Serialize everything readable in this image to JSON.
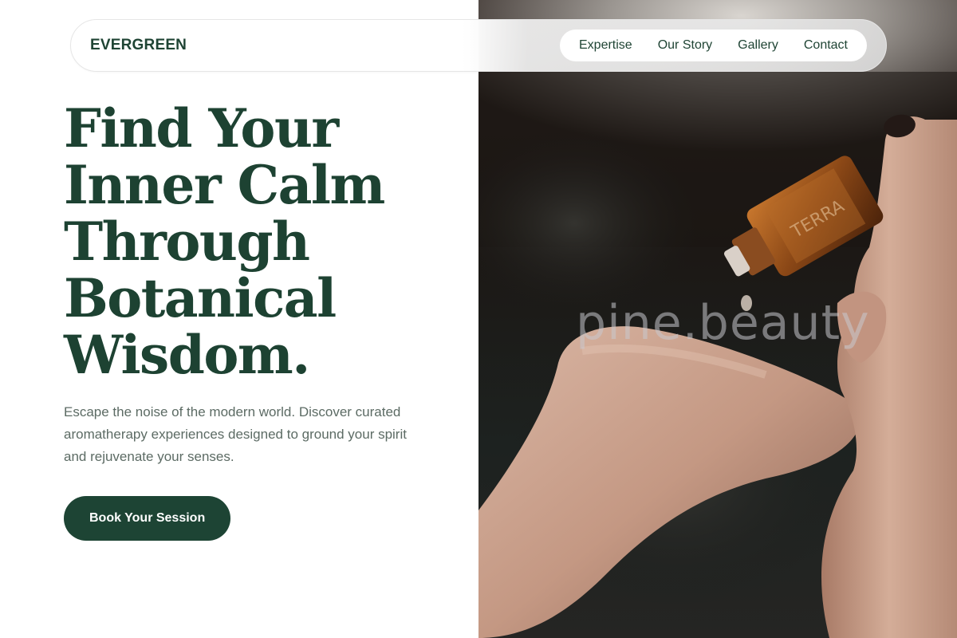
{
  "brand": {
    "name": "EVERGREEN"
  },
  "nav": {
    "links": [
      {
        "label": "Expertise"
      },
      {
        "label": "Our Story"
      },
      {
        "label": "Gallery"
      },
      {
        "label": "Contact"
      }
    ]
  },
  "hero": {
    "headline_lines": [
      "Find Your",
      "Inner Calm",
      "Through",
      "Botanical",
      "Wisdom."
    ],
    "subtext": "Escape the noise of the modern world. Discover curated aromatherapy experiences designed to ground your spirit and rejuvenate your senses.",
    "cta_label": "Book Your Session"
  },
  "photo": {
    "watermark": "pine.beauty"
  },
  "colors": {
    "primary_green": "#1d4434",
    "body_text": "#5c6b64",
    "background": "#ffffff"
  }
}
